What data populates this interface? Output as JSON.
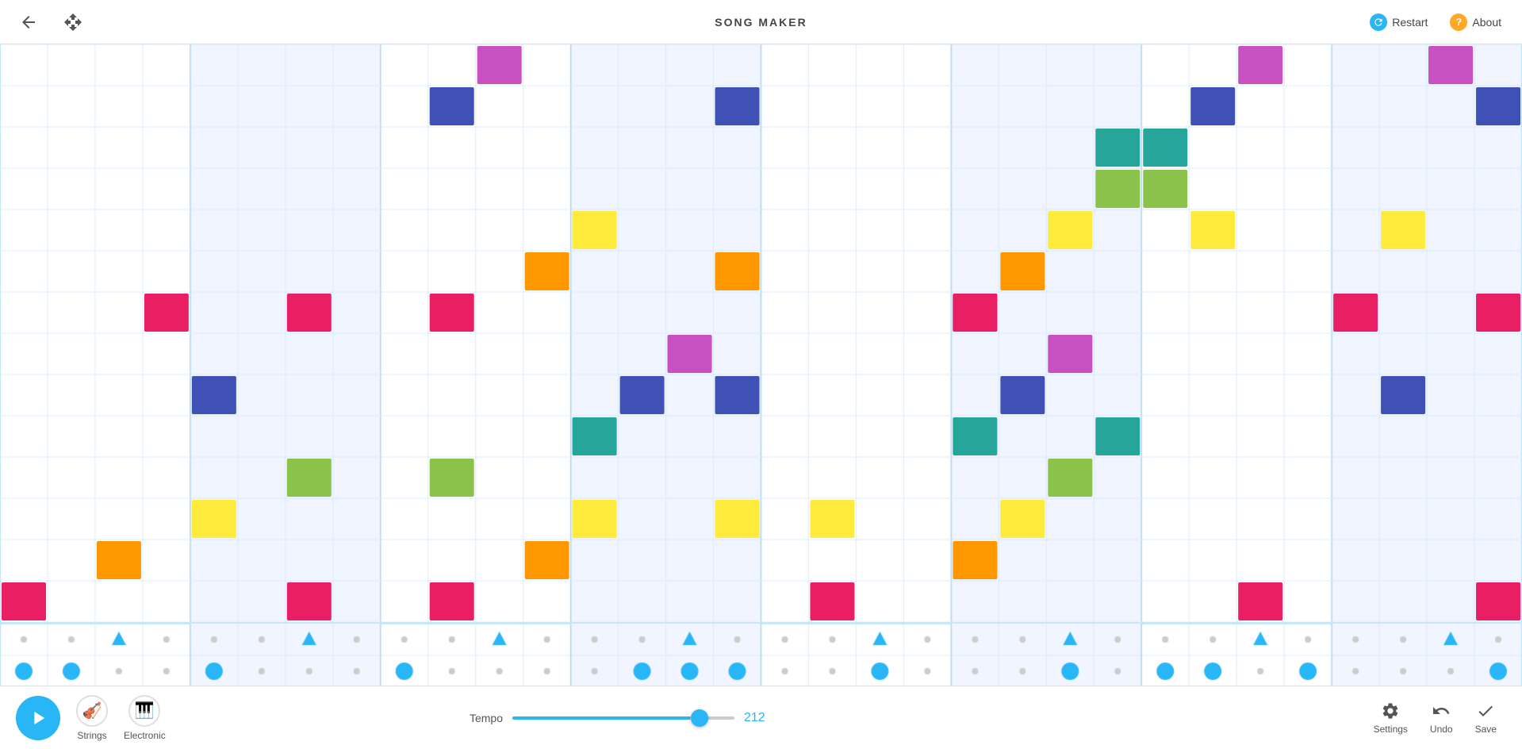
{
  "header": {
    "title": "SONG MAKER",
    "back_label": "←",
    "move_label": "⊕",
    "restart_label": "Restart",
    "about_label": "About"
  },
  "footer": {
    "play_label": "▶",
    "instruments": [
      {
        "id": "strings",
        "label": "Strings",
        "icon": "🎻"
      },
      {
        "id": "electronic",
        "label": "Electronic",
        "icon": "🎹"
      }
    ],
    "tempo_label": "Tempo",
    "tempo_value": "212",
    "tempo_min": "20",
    "tempo_max": "240",
    "settings_label": "Settings",
    "undo_label": "Undo",
    "save_label": "Save"
  },
  "grid": {
    "rows": 14,
    "cols": 32,
    "beat_cols": [
      0,
      4,
      8,
      12,
      16,
      20,
      24,
      28
    ],
    "shaded_groups": [
      [
        4,
        7
      ],
      [
        12,
        15
      ],
      [
        20,
        23
      ],
      [
        28,
        31
      ]
    ]
  },
  "notes": [
    {
      "row": 1,
      "col": 10,
      "color": "#c850c0"
    },
    {
      "row": 2,
      "col": 9,
      "color": "#3f51b5"
    },
    {
      "row": 2,
      "col": 15,
      "color": "#3f51b5"
    },
    {
      "row": 3,
      "col": 23,
      "color": "#26a69a"
    },
    {
      "row": 4,
      "col": 24,
      "color": "#8bc34a"
    },
    {
      "row": 5,
      "col": 12,
      "color": "#ffeb3b"
    },
    {
      "row": 5,
      "col": 25,
      "color": "#ffeb3b"
    },
    {
      "row": 6,
      "col": 11,
      "color": "#ff9800"
    },
    {
      "row": 6,
      "col": 15,
      "color": "#ff9800"
    },
    {
      "row": 7,
      "col": 3,
      "color": "#e91e63"
    },
    {
      "row": 7,
      "col": 6,
      "color": "#e91e63"
    },
    {
      "row": 7,
      "col": 9,
      "color": "#e91e63"
    },
    {
      "row": 7,
      "col": 20,
      "color": "#e91e63"
    },
    {
      "row": 8,
      "col": 14,
      "color": "#c850c0"
    },
    {
      "row": 9,
      "col": 4,
      "color": "#3f51b5"
    },
    {
      "row": 9,
      "col": 13,
      "color": "#3f51b5"
    },
    {
      "row": 9,
      "col": 15,
      "color": "#3f51b5"
    },
    {
      "row": 10,
      "col": 12,
      "color": "#26a69a"
    },
    {
      "row": 10,
      "col": 23,
      "color": "#26a69a"
    },
    {
      "row": 11,
      "col": 6,
      "color": "#8bc34a"
    },
    {
      "row": 11,
      "col": 9,
      "color": "#8bc34a"
    },
    {
      "row": 12,
      "col": 4,
      "color": "#ffeb3b"
    },
    {
      "row": 12,
      "col": 12,
      "color": "#ffeb3b"
    },
    {
      "row": 12,
      "col": 15,
      "color": "#ffeb3b"
    },
    {
      "row": 12,
      "col": 17,
      "color": "#ffeb3b"
    },
    {
      "row": 13,
      "col": 2,
      "color": "#ff9800"
    },
    {
      "row": 13,
      "col": 11,
      "color": "#ff9800"
    },
    {
      "row": 14,
      "col": 0,
      "color": "#e91e63"
    },
    {
      "row": 14,
      "col": 6,
      "color": "#e91e63"
    },
    {
      "row": 14,
      "col": 9,
      "color": "#e91e63"
    },
    {
      "row": 14,
      "col": 17,
      "color": "#e91e63"
    },
    {
      "row": 1,
      "col": 26,
      "color": "#c850c0"
    },
    {
      "row": 1,
      "col": 30,
      "color": "#c850c0"
    },
    {
      "row": 2,
      "col": 25,
      "color": "#3f51b5"
    },
    {
      "row": 2,
      "col": 31,
      "color": "#3f51b5"
    },
    {
      "row": 3,
      "col": 24,
      "color": "#26a69a"
    },
    {
      "row": 4,
      "col": 23,
      "color": "#8bc34a"
    },
    {
      "row": 5,
      "col": 22,
      "color": "#ffeb3b"
    },
    {
      "row": 5,
      "col": 29,
      "color": "#ffeb3b"
    },
    {
      "row": 6,
      "col": 21,
      "color": "#ff9800"
    },
    {
      "row": 7,
      "col": 20,
      "color": "#e91e63"
    },
    {
      "row": 7,
      "col": 28,
      "color": "#e91e63"
    },
    {
      "row": 7,
      "col": 31,
      "color": "#e91e63"
    },
    {
      "row": 8,
      "col": 22,
      "color": "#c850c0"
    },
    {
      "row": 9,
      "col": 21,
      "color": "#3f51b5"
    },
    {
      "row": 9,
      "col": 29,
      "color": "#3f51b5"
    },
    {
      "row": 10,
      "col": 20,
      "color": "#26a69a"
    },
    {
      "row": 11,
      "col": 22,
      "color": "#8bc34a"
    },
    {
      "row": 12,
      "col": 21,
      "color": "#ffeb3b"
    },
    {
      "row": 13,
      "col": 20,
      "color": "#ff9800"
    },
    {
      "row": 14,
      "col": 26,
      "color": "#e91e63"
    },
    {
      "row": 14,
      "col": 31,
      "color": "#e91e63"
    }
  ],
  "percussion": {
    "row1_label": "triangle",
    "row2_label": "circle",
    "row1_active": [
      2,
      6,
      10,
      14,
      18,
      22,
      26,
      30
    ],
    "row2_active": [
      0,
      1,
      4,
      8,
      13,
      14,
      15,
      18,
      22,
      24,
      25,
      27,
      31
    ]
  }
}
